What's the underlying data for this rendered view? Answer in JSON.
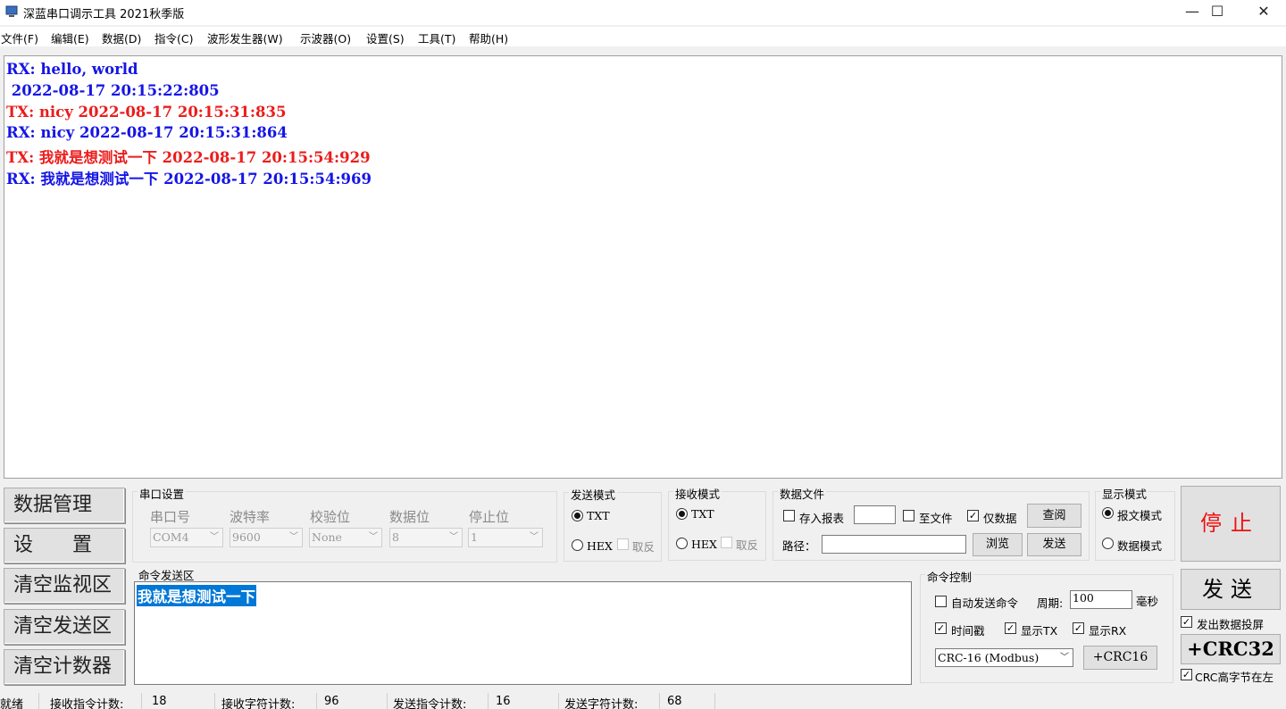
{
  "window": {
    "title": "深蓝串口调示工具 2021秋季版",
    "controls": {
      "minimize": "—",
      "maximize": "☐",
      "close": "✕"
    }
  },
  "menu": [
    "文件(F)",
    "编辑(E)",
    "数据(D)",
    "指令(C)",
    "波形发生器(W)",
    "示波器(O)",
    "设置(S)",
    "工具(T)",
    "帮助(H)"
  ],
  "monitor": {
    "lines": [
      {
        "text": "RX: hello, world",
        "dir": "rx"
      },
      {
        "text": " 2022-08-17 20:15:22:805",
        "dir": "rx"
      },
      {
        "text": "TX: nicy 2022-08-17 20:15:31:835",
        "dir": "tx"
      },
      {
        "text": "RX: nicy 2022-08-17 20:15:31:864",
        "dir": "rx"
      },
      {
        "text": "TX: 我就是想测试一下 2022-08-17 20:15:54:929",
        "dir": "tx"
      },
      {
        "text": "RX: 我就是想测试一下 2022-08-17 20:15:54:969",
        "dir": "rx"
      }
    ],
    "colors": {
      "rx": "#1515e6",
      "tx": "#ec1c1c"
    }
  },
  "left_buttons": [
    "数据管理",
    "设　　置",
    "清空监视区",
    "清空发送区",
    "清空计数器"
  ],
  "serial": {
    "title": "串口设置",
    "labels": [
      "串口号",
      "波特率",
      "校验位",
      "数据位",
      "停止位"
    ],
    "values": [
      "COM4",
      "9600",
      "None",
      "8",
      "1"
    ]
  },
  "send_mode": {
    "title": "发送模式",
    "txt": "TXT",
    "hex": "HEX",
    "invert": "取反"
  },
  "recv_mode": {
    "title": "接收模式",
    "txt": "TXT",
    "hex": "HEX",
    "invert": "取反"
  },
  "data_file": {
    "title": "数据文件",
    "save_report": "存入报表",
    "to_file": "至文件",
    "data_only": "仅数据",
    "query": "查阅",
    "path_label": "路径：",
    "browse": "浏览",
    "send": "发送"
  },
  "display_mode": {
    "title": "显示模式",
    "report": "报文模式",
    "data": "数据模式"
  },
  "stop_label": "停止",
  "cmd_send": {
    "title": "命令发送区",
    "text": "我就是想测试一下"
  },
  "cmd_control": {
    "title": "命令控制",
    "auto_send": "自动发送命令",
    "period_label": "周期:",
    "period_value": "100",
    "ms": "毫秒",
    "timestamp": "时间戳",
    "show_tx": "显示TX",
    "show_rx": "显示RX",
    "crc_select": "CRC-16 (Modbus)",
    "crc16_btn": "+CRC16"
  },
  "right": {
    "send": "发送",
    "echo": "发出数据投屏",
    "crc32": "+CRC32",
    "crc_high_left": "CRC高字节在左"
  },
  "status": {
    "ready": "就绪",
    "recv_cmd_label": "接收指令计数:",
    "recv_cmd_value": "18",
    "recv_char_label": "接收字符计数:",
    "recv_char_value": "96",
    "send_cmd_label": "发送指令计数:",
    "send_cmd_value": "16",
    "send_char_label": "发送字符计数:",
    "send_char_value": "68"
  }
}
